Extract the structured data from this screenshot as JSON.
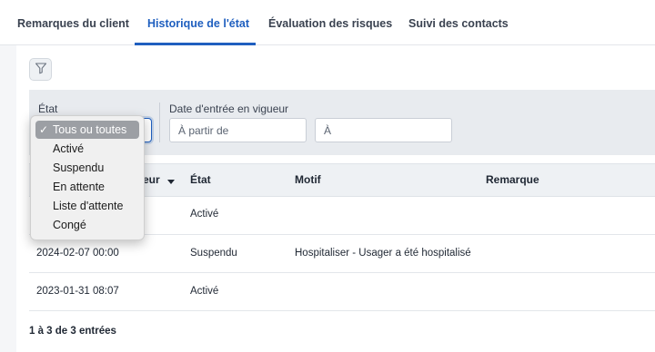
{
  "tabs": [
    {
      "label": "Remarques du client"
    },
    {
      "label": "Historique de l'état"
    },
    {
      "label": "Évaluation des risques"
    },
    {
      "label": "Suivi des contacts"
    }
  ],
  "active_tab": "Historique de l'état",
  "filters": {
    "state_label": "État",
    "date_label": "Date d'entrée en vigueur",
    "from_placeholder": "À partir de",
    "to_placeholder": "À"
  },
  "dropdown": {
    "selected": "Tous ou toutes",
    "options": [
      "Tous ou toutes",
      "Activé",
      "Suspendu",
      "En attente",
      "Liste d'attente",
      "Congé"
    ]
  },
  "table": {
    "headers": [
      "Date d'entrée en vigueur",
      "État",
      "Motif",
      "Remarque"
    ],
    "visible_first_header_fragment": "eur",
    "rows": [
      {
        "date": "",
        "state": "Activé",
        "reason": "",
        "remark": ""
      },
      {
        "date": "2024-02-07 00:00",
        "state": "Suspendu",
        "reason": "Hospitaliser - Usager a été hospitalisé",
        "remark": ""
      },
      {
        "date": "2023-01-31 08:07",
        "state": "Activé",
        "reason": "",
        "remark": ""
      }
    ]
  },
  "footer": {
    "entries": "1 à 3 de 3 entrées"
  },
  "colors": {
    "accent": "#1f5fbf"
  },
  "icons": {
    "filter": "filter-icon",
    "check": "checkmark-icon",
    "sort": "sort-descending-icon"
  }
}
